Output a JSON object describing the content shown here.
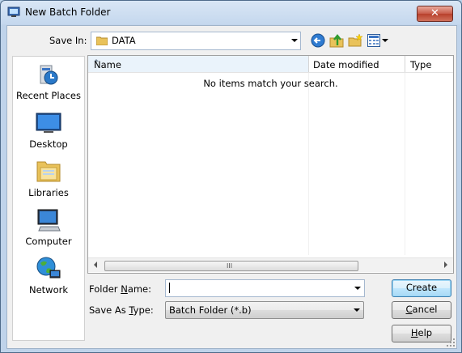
{
  "window": {
    "title": "New Batch Folder",
    "close_glyph": "✕"
  },
  "toolbar": {
    "save_in_label": "Save In:",
    "save_in_value": "DATA",
    "icons": [
      "back-arrow-icon",
      "up-folder-icon",
      "new-folder-icon",
      "view-menu-icon"
    ]
  },
  "places": [
    {
      "label": "Recent Places",
      "icon": "recent-places-icon"
    },
    {
      "label": "Desktop",
      "icon": "desktop-icon"
    },
    {
      "label": "Libraries",
      "icon": "libraries-icon"
    },
    {
      "label": "Computer",
      "icon": "computer-icon"
    },
    {
      "label": "Network",
      "icon": "network-icon"
    }
  ],
  "file_list": {
    "columns": [
      "Name",
      "Date modified",
      "Type"
    ],
    "empty_message": "No items match your search.",
    "scroll_grip": "III"
  },
  "form": {
    "folder_name_label": "Folder Name:",
    "folder_name_value": "",
    "save_as_type_label": "Save As Type:",
    "save_as_type_value": "Batch Folder (*.b)"
  },
  "buttons": {
    "create": "Create",
    "cancel": "Cancel",
    "help": "Help"
  },
  "colors": {
    "accent": "#3c7fb1",
    "title_bar": "#c5d8ee",
    "close": "#c75a48"
  }
}
